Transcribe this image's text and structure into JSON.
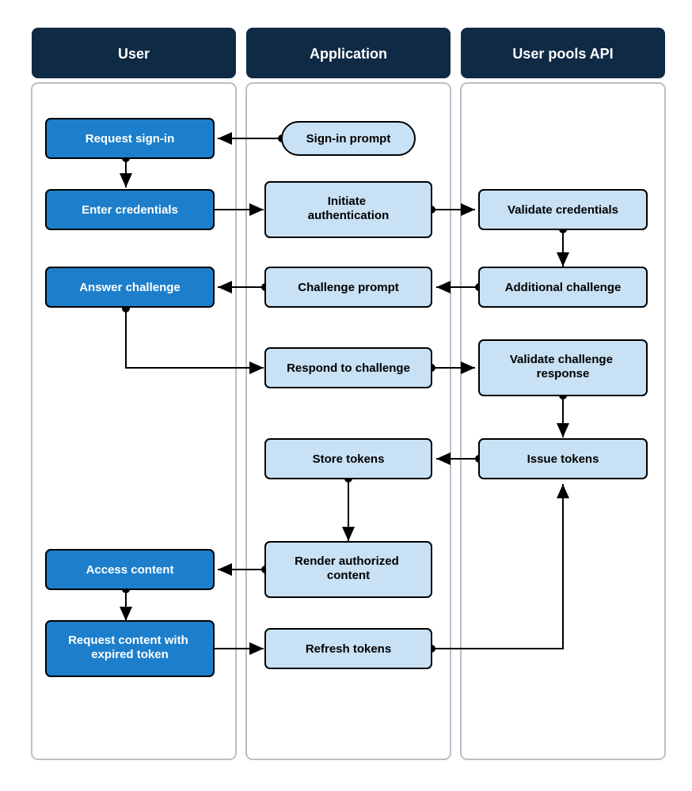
{
  "lanes": {
    "user": {
      "header": "User"
    },
    "application": {
      "header": "Application"
    },
    "api": {
      "header": "User pools API"
    }
  },
  "nodes": {
    "signin_prompt": "Sign-in prompt",
    "request_signin": "Request sign-in",
    "enter_credentials": "Enter credentials",
    "initiate_auth": "Initiate\nauthentication",
    "validate_credentials": "Validate credentials",
    "additional_challenge": "Additional challenge",
    "challenge_prompt": "Challenge prompt",
    "answer_challenge": "Answer challenge",
    "respond_challenge": "Respond to challenge",
    "validate_challenge": "Validate challenge\nresponse",
    "issue_tokens": "Issue tokens",
    "store_tokens": "Store tokens",
    "render_content": "Render authorized\ncontent",
    "access_content": "Access content",
    "request_expired": "Request content with\nexpired token",
    "refresh_tokens": "Refresh tokens"
  },
  "colors": {
    "lane_header_bg": "#0f2a44",
    "lane_body_bg": "#ffffff",
    "lane_border": "#a8b0b8",
    "dark_box_bg": "#1d7fcb",
    "light_box_bg": "#c8e1f5",
    "box_border": "#000000",
    "arrow": "#000000"
  },
  "chart_data": {
    "type": "flowchart",
    "swimlanes": [
      "User",
      "Application",
      "User pools API"
    ],
    "nodes": [
      {
        "id": "signin_prompt",
        "lane": "Application",
        "label": "Sign-in prompt",
        "shape": "capsule"
      },
      {
        "id": "request_signin",
        "lane": "User",
        "label": "Request sign-in",
        "shape": "rect"
      },
      {
        "id": "enter_credentials",
        "lane": "User",
        "label": "Enter credentials",
        "shape": "rect"
      },
      {
        "id": "initiate_auth",
        "lane": "Application",
        "label": "Initiate authentication",
        "shape": "rect"
      },
      {
        "id": "validate_credentials",
        "lane": "User pools API",
        "label": "Validate credentials",
        "shape": "rect"
      },
      {
        "id": "additional_challenge",
        "lane": "User pools API",
        "label": "Additional challenge",
        "shape": "rect"
      },
      {
        "id": "challenge_prompt",
        "lane": "Application",
        "label": "Challenge prompt",
        "shape": "rect"
      },
      {
        "id": "answer_challenge",
        "lane": "User",
        "label": "Answer challenge",
        "shape": "rect"
      },
      {
        "id": "respond_challenge",
        "lane": "Application",
        "label": "Respond to challenge",
        "shape": "rect"
      },
      {
        "id": "validate_challenge",
        "lane": "User pools API",
        "label": "Validate challenge response",
        "shape": "rect"
      },
      {
        "id": "issue_tokens",
        "lane": "User pools API",
        "label": "Issue tokens",
        "shape": "rect"
      },
      {
        "id": "store_tokens",
        "lane": "Application",
        "label": "Store tokens",
        "shape": "rect"
      },
      {
        "id": "render_content",
        "lane": "Application",
        "label": "Render authorized content",
        "shape": "rect"
      },
      {
        "id": "access_content",
        "lane": "User",
        "label": "Access content",
        "shape": "rect"
      },
      {
        "id": "request_expired",
        "lane": "User",
        "label": "Request content with expired token",
        "shape": "rect"
      },
      {
        "id": "refresh_tokens",
        "lane": "Application",
        "label": "Refresh tokens",
        "shape": "rect"
      }
    ],
    "edges": [
      {
        "from": "signin_prompt",
        "to": "request_signin"
      },
      {
        "from": "request_signin",
        "to": "enter_credentials"
      },
      {
        "from": "enter_credentials",
        "to": "initiate_auth"
      },
      {
        "from": "initiate_auth",
        "to": "validate_credentials"
      },
      {
        "from": "validate_credentials",
        "to": "additional_challenge"
      },
      {
        "from": "additional_challenge",
        "to": "challenge_prompt"
      },
      {
        "from": "challenge_prompt",
        "to": "answer_challenge"
      },
      {
        "from": "answer_challenge",
        "to": "respond_challenge"
      },
      {
        "from": "respond_challenge",
        "to": "validate_challenge"
      },
      {
        "from": "validate_challenge",
        "to": "issue_tokens"
      },
      {
        "from": "issue_tokens",
        "to": "store_tokens"
      },
      {
        "from": "store_tokens",
        "to": "render_content"
      },
      {
        "from": "render_content",
        "to": "access_content"
      },
      {
        "from": "access_content",
        "to": "request_expired"
      },
      {
        "from": "request_expired",
        "to": "refresh_tokens"
      },
      {
        "from": "refresh_tokens",
        "to": "issue_tokens"
      }
    ]
  }
}
